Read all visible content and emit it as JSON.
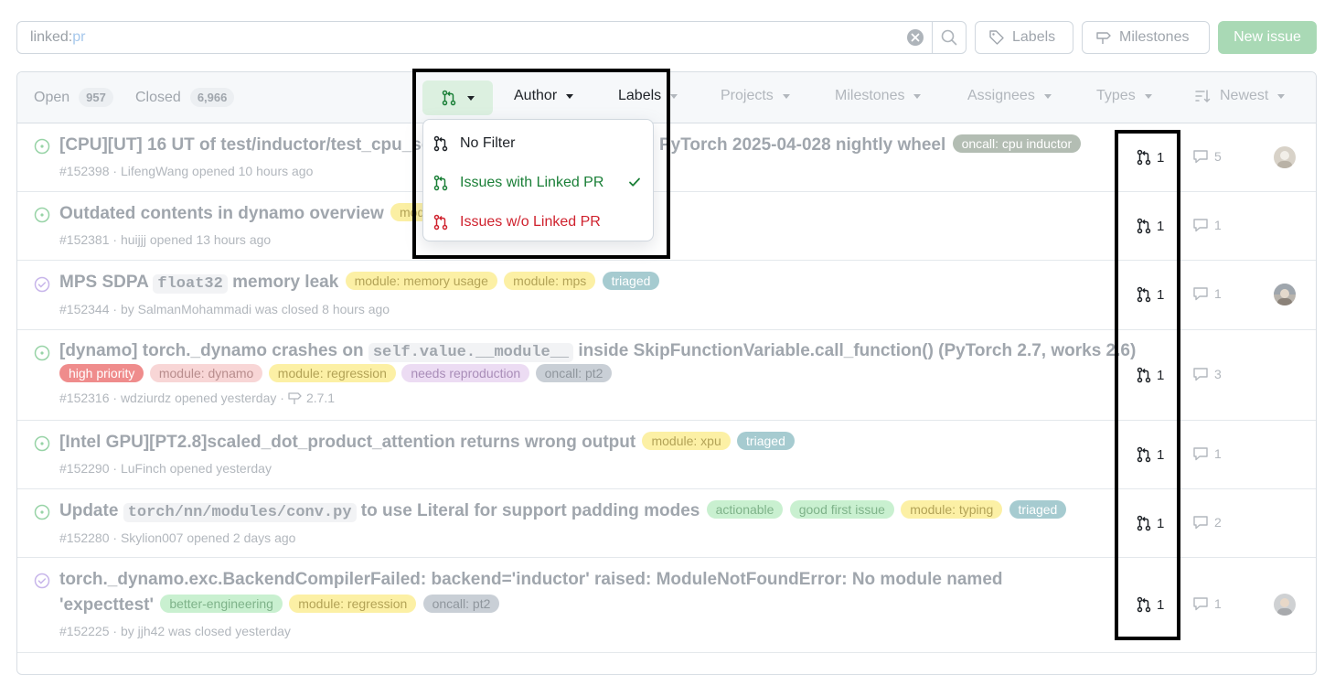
{
  "search": {
    "query_prefix": "linked:",
    "query_value": "pr"
  },
  "toolbar": {
    "labels": "Labels",
    "milestones": "Milestones",
    "new_issue": "New issue"
  },
  "tabs": {
    "open_label": "Open",
    "open_count": "957",
    "closed_label": "Closed",
    "closed_count": "6,966"
  },
  "filters": {
    "author": "Author",
    "labels": "Labels",
    "projects": "Projects",
    "milestones": "Milestones",
    "assignees": "Assignees",
    "types": "Types",
    "sort": "Newest"
  },
  "menu": {
    "items": [
      {
        "label": "No Filter",
        "color": "#1f2328"
      },
      {
        "label": "Issues with Linked PR",
        "color": "#1a7f37",
        "checked": true
      },
      {
        "label": "Issues w/o Linked PR",
        "color": "#cf222e"
      }
    ]
  },
  "issues": [
    {
      "state": "open",
      "title_a": "[CPU][UT] 16 UT of test/inductor/test_cpu_se",
      "title_b": "PyTorch 2025-04-028 nightly wheel",
      "labels": [
        {
          "name": "oncall: cpu inductor",
          "bg": "#b3bdb3",
          "fg": "#ffffff"
        }
      ],
      "meta": "#152398 · LifengWang opened 10 hours ago",
      "prs": "1",
      "comments": "5",
      "avatar": true
    },
    {
      "state": "open",
      "title": "Outdated contents in dynamo overview",
      "labels": [
        {
          "name": "modu",
          "bg": "#fbefa3",
          "fg": "#b3a357"
        }
      ],
      "meta": "#152381 · huijjj opened 13 hours ago",
      "prs": "1",
      "comments": "1",
      "avatar": false
    },
    {
      "state": "closed",
      "title_a": "MPS SDPA ",
      "title_code": "float32",
      "title_b": " memory leak",
      "labels": [
        {
          "name": "module: memory usage",
          "bg": "#fcf0a5",
          "fg": "#b3a357"
        },
        {
          "name": "module: mps",
          "bg": "#fcf0a5",
          "fg": "#b3a357"
        },
        {
          "name": "triaged",
          "bg": "#a6cbd0",
          "fg": "#ffffff"
        }
      ],
      "meta": "#152344 · by SalmanMohammadi was closed 8 hours ago",
      "prs": "1",
      "comments": "1",
      "avatar": true
    },
    {
      "state": "open",
      "title_a": "[dynamo] torch._dynamo crashes on ",
      "title_code": "self.value.__module__",
      "title_b": " inside SkipFunctionVariable.call_function() (PyTorch 2.7, works 2.6)",
      "labels": [
        {
          "name": "high priority",
          "bg": "#ef8c8c",
          "fg": "#ffffff"
        },
        {
          "name": "module: dynamo",
          "bg": "#f8d6d6",
          "fg": "#b88d8d"
        },
        {
          "name": "module: regression",
          "bg": "#fcf0a5",
          "fg": "#b3a357"
        },
        {
          "name": "needs reproduction",
          "bg": "#ecdcf3",
          "fg": "#a98db8"
        },
        {
          "name": "oncall: pt2",
          "bg": "#c9cfd6",
          "fg": "#8f969d"
        }
      ],
      "meta": "#152316 · wdziurdz opened yesterday ·",
      "milestone": "2.7.1",
      "prs": "1",
      "comments": "3",
      "avatar": false
    },
    {
      "state": "open",
      "title": "[Intel GPU][PT2.8]scaled_dot_product_attention returns wrong output",
      "labels": [
        {
          "name": "module: xpu",
          "bg": "#fcf0a5",
          "fg": "#b3a357"
        },
        {
          "name": "triaged",
          "bg": "#a6cbd0",
          "fg": "#ffffff"
        }
      ],
      "meta": "#152290 · LuFinch opened yesterday",
      "prs": "1",
      "comments": "1",
      "avatar": false
    },
    {
      "state": "open",
      "title_a": "Update ",
      "title_code": "torch/nn/modules/conv.py",
      "title_b": " to use Literal for support padding modes",
      "labels": [
        {
          "name": "actionable",
          "bg": "#c9f0d0",
          "fg": "#7fb38a"
        },
        {
          "name": "good first issue",
          "bg": "#c9f0d0",
          "fg": "#7fb38a"
        },
        {
          "name": "module: typing",
          "bg": "#fcf0a5",
          "fg": "#b3a357"
        },
        {
          "name": "triaged",
          "bg": "#a6cbd0",
          "fg": "#ffffff"
        }
      ],
      "meta": "#152280 · Skylion007 opened 2 days ago",
      "prs": "1",
      "comments": "2",
      "avatar": false
    },
    {
      "state": "closed",
      "title": "torch._dynamo.exc.BackendCompilerFailed: backend='inductor' raised: ModuleNotFoundError: No module named",
      "title_line2": "'expecttest'",
      "labels": [
        {
          "name": "better-engineering",
          "bg": "#c9f0d0",
          "fg": "#7fb38a"
        },
        {
          "name": "module: regression",
          "bg": "#fcf0a5",
          "fg": "#b3a357"
        },
        {
          "name": "oncall: pt2",
          "bg": "#c9cfd6",
          "fg": "#8f969d"
        }
      ],
      "meta": "#152225 · by jjh42 was closed yesterday",
      "prs": "1",
      "comments": "1",
      "avatar": true
    }
  ],
  "colors": {
    "open": "#97d3a6",
    "closed": "#c7b5ea",
    "accent_green": "#1a7f37",
    "danger": "#cf222e"
  }
}
